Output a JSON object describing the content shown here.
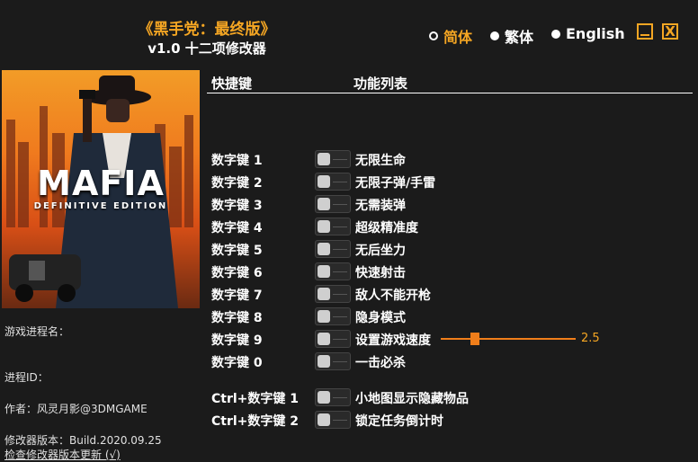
{
  "header": {
    "game_title": "《黑手党：最终版》",
    "subtitle": "v1.0 十二项修改器"
  },
  "languages": [
    {
      "label": "简体",
      "selected": true
    },
    {
      "label": "繁体",
      "selected": false
    },
    {
      "label": "English",
      "selected": false
    }
  ],
  "window": {
    "minimize_icon": "minimize-icon",
    "close_icon": "close-icon",
    "close_glyph": "X"
  },
  "cover": {
    "logo": "MAFIA",
    "edition": "DEFINITIVE EDITION"
  },
  "info": {
    "process_label": "游戏进程名：",
    "pid_label": "进程ID：",
    "author": "作者：风灵月影@3DMGAME",
    "version": "修改器版本：Build.2020.09.25",
    "update_link": "检查修改器版本更新 (√)"
  },
  "table": {
    "col_hotkey": "快捷键",
    "col_functions": "功能列表"
  },
  "cheats": [
    {
      "key": "数字键 1",
      "label": "无限生命"
    },
    {
      "key": "数字键 2",
      "label": "无限子弹/手雷"
    },
    {
      "key": "数字键 3",
      "label": "无需装弹"
    },
    {
      "key": "数字键 4",
      "label": "超级精准度"
    },
    {
      "key": "数字键 5",
      "label": "无后坐力"
    },
    {
      "key": "数字键 6",
      "label": "快速射击"
    },
    {
      "key": "数字键 7",
      "label": "敌人不能开枪"
    },
    {
      "key": "数字键 8",
      "label": "隐身模式"
    },
    {
      "key": "数字键 9",
      "label": "设置游戏速度"
    },
    {
      "key": "数字键 0",
      "label": "一击必杀"
    },
    {
      "key": "Ctrl+数字键 1",
      "label": "小地图显示隐藏物品"
    },
    {
      "key": "Ctrl+数字键 2",
      "label": "锁定任务倒计时"
    }
  ],
  "speed_slider": {
    "value": "2.5",
    "accent": "#f07e1a"
  },
  "colors": {
    "accent": "#f5a623",
    "background": "#1b1b1b",
    "text": "#ffffff"
  }
}
